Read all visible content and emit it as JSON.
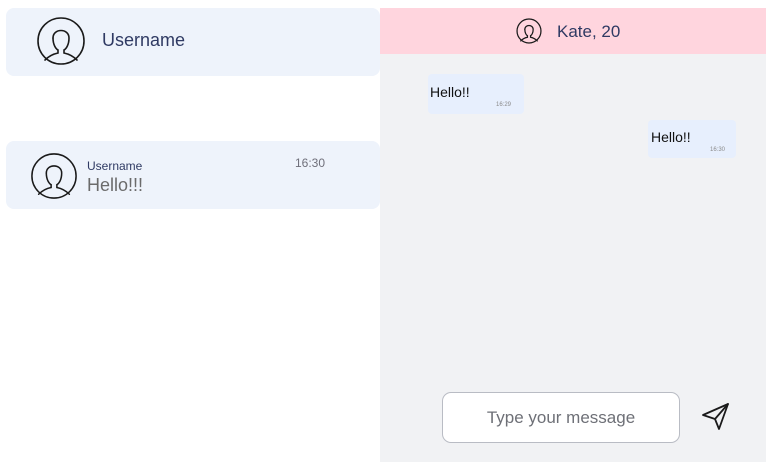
{
  "profile": {
    "name": "Username",
    "icon": "user-avatar-icon"
  },
  "chat_list": {
    "items": [
      {
        "name": "Username",
        "preview": "Hello!!!",
        "time": "16:30",
        "icon": "user-avatar-icon"
      }
    ]
  },
  "chat": {
    "header": {
      "title": "Kate, 20",
      "icon": "user-avatar-icon"
    },
    "messages": [
      {
        "direction": "incoming",
        "text": "Hello!!",
        "time": "16:29"
      },
      {
        "direction": "outgoing",
        "text": "Hello!!",
        "time": "16:30"
      }
    ],
    "composer": {
      "placeholder": "Type your message",
      "value": "",
      "send_icon": "send-icon"
    }
  },
  "colors": {
    "card_bg": "#eef3fb",
    "header_bg": "#ffd5de",
    "chat_bg": "#f1f2f4",
    "bubble_bg": "#e7effd",
    "name_text": "#2f3a63"
  }
}
